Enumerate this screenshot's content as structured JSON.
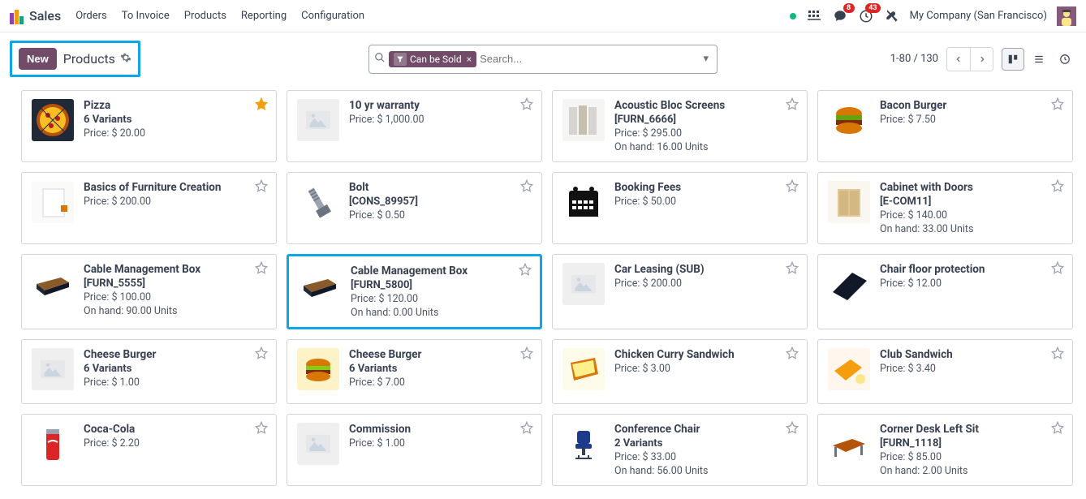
{
  "header": {
    "app": "Sales",
    "menu": [
      "Orders",
      "To Invoice",
      "Products",
      "Reporting",
      "Configuration"
    ],
    "msg_badge": "8",
    "clock_badge": "43",
    "company": "My Company (San Francisco)"
  },
  "controls": {
    "new_label": "New",
    "breadcrumb": "Products",
    "chip_label": "Can be Sold",
    "search_placeholder": "Search...",
    "pager": "1-80 / 130"
  },
  "products": [
    {
      "name": "Pizza",
      "sub": "6 Variants",
      "price": "Price: $ 20.00",
      "onhand": "",
      "fav": true,
      "img": "pizza"
    },
    {
      "name": "10 yr warranty",
      "sub": "",
      "price": "Price: $ 1,000.00",
      "onhand": "",
      "fav": false,
      "img": "placeholder"
    },
    {
      "name": "Acoustic Bloc Screens",
      "sub": "[FURN_6666]",
      "price": "Price: $ 295.00",
      "onhand": "On hand: 16.00 Units",
      "fav": false,
      "img": "panel"
    },
    {
      "name": "Bacon Burger",
      "sub": "",
      "price": "Price: $ 7.50",
      "onhand": "",
      "fav": false,
      "img": "burger"
    },
    {
      "name": "Basics of Furniture Creation",
      "sub": "",
      "price": "Price: $ 200.00",
      "onhand": "",
      "fav": false,
      "img": "book"
    },
    {
      "name": "Bolt",
      "sub": "[CONS_89957]",
      "price": "Price: $ 0.50",
      "onhand": "",
      "fav": false,
      "img": "bolt"
    },
    {
      "name": "Booking Fees",
      "sub": "",
      "price": "Price: $ 50.00",
      "onhand": "",
      "fav": false,
      "img": "calendar"
    },
    {
      "name": "Cabinet with Doors",
      "sub": "[E-COM11]",
      "price": "Price: $ 140.00",
      "onhand": "On hand: 33.00 Units",
      "fav": false,
      "img": "cabinet"
    },
    {
      "name": "Cable Management Box",
      "sub": "[FURN_5555]",
      "price": "Price: $ 100.00",
      "onhand": "On hand: 90.00 Units",
      "fav": false,
      "img": "cablebox"
    },
    {
      "name": "Cable Management Box",
      "sub": "[FURN_5800]",
      "price": "Price: $ 120.00",
      "onhand": "On hand: 0.00 Units",
      "fav": false,
      "img": "cablebox",
      "hl": true
    },
    {
      "name": "Car Leasing (SUB)",
      "sub": "",
      "price": "Price: $ 200.00",
      "onhand": "",
      "fav": false,
      "img": "placeholder"
    },
    {
      "name": "Chair floor protection",
      "sub": "",
      "price": "Price: $ 12.00",
      "onhand": "",
      "fav": false,
      "img": "mat"
    },
    {
      "name": "Cheese Burger",
      "sub": "6 Variants",
      "price": "Price: $ 1.00",
      "onhand": "",
      "fav": false,
      "img": "placeholder"
    },
    {
      "name": "Cheese Burger",
      "sub": "6 Variants",
      "price": "Price: $ 7.00",
      "onhand": "",
      "fav": false,
      "img": "burger2"
    },
    {
      "name": "Chicken Curry Sandwich",
      "sub": "",
      "price": "Price: $ 3.00",
      "onhand": "",
      "fav": false,
      "img": "sandwich"
    },
    {
      "name": "Club Sandwich",
      "sub": "",
      "price": "Price: $ 3.40",
      "onhand": "",
      "fav": false,
      "img": "sandwich2"
    },
    {
      "name": "Coca-Cola",
      "sub": "",
      "price": "Price: $ 2.20",
      "onhand": "",
      "fav": false,
      "img": "coke"
    },
    {
      "name": "Commission",
      "sub": "",
      "price": "Price: $ 1.00",
      "onhand": "",
      "fav": false,
      "img": "placeholder"
    },
    {
      "name": "Conference Chair",
      "sub": "2 Variants",
      "price": "Price: $ 33.00",
      "onhand": "On hand: 56.00 Units",
      "fav": false,
      "img": "chair"
    },
    {
      "name": "Corner Desk Left Sit",
      "sub": "[FURN_1118]",
      "price": "Price: $ 85.00",
      "onhand": "On hand: 2.00 Units",
      "fav": false,
      "img": "desk"
    }
  ]
}
